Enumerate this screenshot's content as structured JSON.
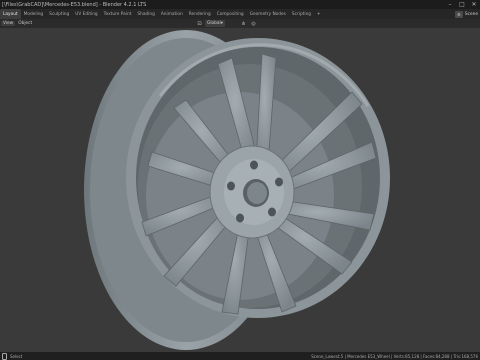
{
  "window": {
    "title": "[\\Files\\GrabCAD]\\Mercedes-E53.blend] - Blender 4.2.1 LTS",
    "minimize": "–",
    "maximize": "□",
    "close": "✕"
  },
  "tabs": [
    "Layout",
    "Modeling",
    "Sculpting",
    "UV Editing",
    "Texture Paint",
    "Shading",
    "Animation",
    "Rendering",
    "Compositing",
    "Geometry Nodes",
    "Scripting"
  ],
  "active_tab": 0,
  "add_tab": "+",
  "scene": {
    "badge": "⚙",
    "label": "Scene"
  },
  "header": {
    "view": "View",
    "object": "Object"
  },
  "orientation": {
    "select_icon": "select-box-icon",
    "value": "Global",
    "dropdown_icon": "▾"
  },
  "viewport_icons": [
    "snap-icon",
    "proportional-icon"
  ],
  "status": {
    "select": "Select",
    "stats": "Scene_Lowest.5 | Mercedes E53_Wheel | Verts:85,128 | Faces:84,288 | Tris:168,576"
  },
  "colors": {
    "background": "#3a3a3a",
    "wheel": "#8e979c",
    "ui_dark": "#1c1c1c"
  }
}
